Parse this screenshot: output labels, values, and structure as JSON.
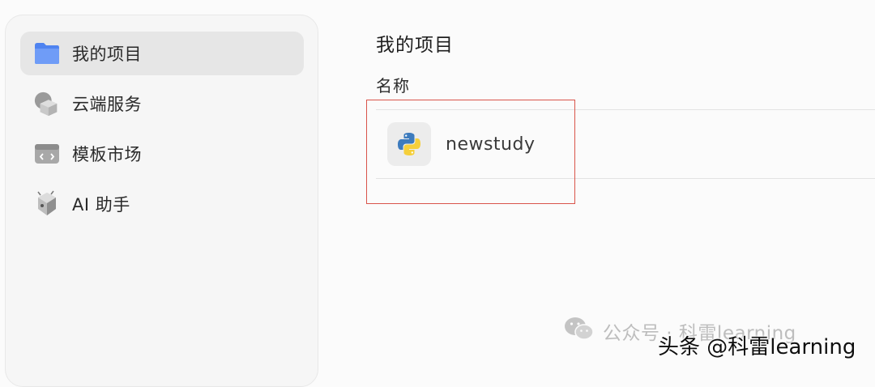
{
  "sidebar": {
    "items": [
      {
        "label": "我的项目",
        "icon": "folder-icon",
        "active": true
      },
      {
        "label": "云端服务",
        "icon": "cloud-cube-icon",
        "active": false
      },
      {
        "label": "模板市场",
        "icon": "template-icon",
        "active": false
      },
      {
        "label": "AI 助手",
        "icon": "ai-assistant-icon",
        "active": false
      }
    ]
  },
  "main": {
    "title": "我的项目",
    "column_header": "名称",
    "projects": [
      {
        "name": "newstudy",
        "icon": "python-icon"
      }
    ]
  },
  "watermark": {
    "wechat": "公众号 · 科雷learning",
    "toutiao": "头条 @科雷learning"
  },
  "colors": {
    "highlight_border": "#d9544a",
    "folder_blue": "#5b8ef5",
    "python_blue": "#3d7bbd",
    "python_yellow": "#f5cf3b"
  }
}
